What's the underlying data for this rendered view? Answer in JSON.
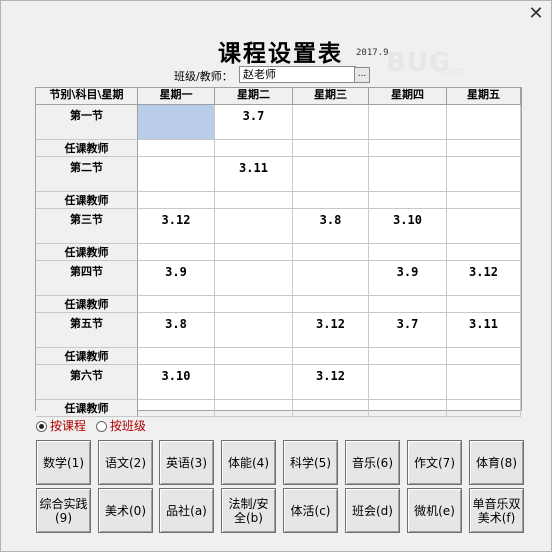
{
  "window": {
    "close_glyph": "✕",
    "title": "课程设置表",
    "date": "2017.9",
    "watermark": "BUG",
    "watermark_small": ".com"
  },
  "teacher_field": {
    "label": "班级/教师：",
    "value": "赵老师",
    "browse": "..."
  },
  "grid": {
    "corner": "节别\\科目\\星期",
    "days": [
      "星期一",
      "星期二",
      "星期三",
      "星期四",
      "星期五"
    ],
    "teacher_row_label": "任课教师",
    "periods": [
      {
        "label": "第一节",
        "cells": [
          "",
          "3.7",
          "",
          "",
          ""
        ]
      },
      {
        "label": "第二节",
        "cells": [
          "",
          "3.11",
          "",
          "",
          ""
        ]
      },
      {
        "label": "第三节",
        "cells": [
          "3.12",
          "",
          "3.8",
          "3.10",
          ""
        ]
      },
      {
        "label": "第四节",
        "cells": [
          "3.9",
          "",
          "",
          "3.9",
          "3.12"
        ]
      },
      {
        "label": "第五节",
        "cells": [
          "3.8",
          "",
          "3.12",
          "3.7",
          "3.11"
        ]
      },
      {
        "label": "第六节",
        "cells": [
          "3.10",
          "",
          "3.12",
          "",
          ""
        ]
      }
    ]
  },
  "mode": {
    "by_course": "按课程",
    "by_class": "按班级",
    "selected": "by_course"
  },
  "buttons": [
    "数学(1)",
    "语文(2)",
    "英语(3)",
    "体能(4)",
    "科学(5)",
    "音乐(6)",
    "作文(7)",
    "体育(8)",
    "综合实践(9)",
    "美术(0)",
    "品社(a)",
    "法制/安全(b)",
    "体活(c)",
    "班会(d)",
    "微机(e)",
    "单音乐双美术(f)"
  ],
  "colors": {
    "selected_cell": "#b9cde8",
    "radio_text": "#b00000"
  }
}
